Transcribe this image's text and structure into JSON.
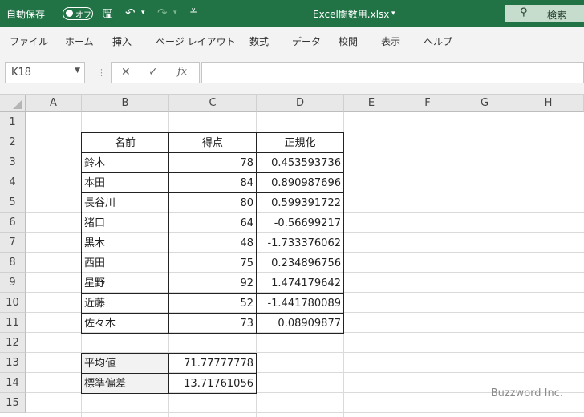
{
  "titlebar": {
    "autosave_label": "自動保存",
    "toggle_state": "オフ",
    "document_title": "Excel関数用.xlsx",
    "search_label": "検索"
  },
  "ribbon_tabs": [
    "ファイル",
    "ホーム",
    "挿入",
    "ページ レイアウト",
    "数式",
    "データ",
    "校閲",
    "表示",
    "ヘルプ"
  ],
  "formula_bar": {
    "name_box": "K18",
    "formula": ""
  },
  "columns": [
    "A",
    "B",
    "C",
    "D",
    "E",
    "F",
    "G",
    "H"
  ],
  "rows": [
    "1",
    "2",
    "3",
    "4",
    "5",
    "6",
    "7",
    "8",
    "9",
    "10",
    "11",
    "12",
    "13",
    "14",
    "15"
  ],
  "table": {
    "headers": [
      "名前",
      "得点",
      "正規化"
    ],
    "rows": [
      [
        "鈴木",
        "78",
        "0.453593736"
      ],
      [
        "本田",
        "84",
        "0.890987696"
      ],
      [
        "長谷川",
        "80",
        "0.599391722"
      ],
      [
        "猪口",
        "64",
        "-0.56699217"
      ],
      [
        "黒木",
        "48",
        "-1.733376062"
      ],
      [
        "西田",
        "75",
        "0.234896756"
      ],
      [
        "星野",
        "92",
        "1.474179642"
      ],
      [
        "近藤",
        "52",
        "-1.441780089"
      ],
      [
        "佐々木",
        "73",
        "0.08909877"
      ]
    ]
  },
  "stats": [
    {
      "label": "平均値",
      "value": "71.77777778"
    },
    {
      "label": "標準偏差",
      "value": "13.71761056"
    }
  ],
  "watermark": "Buzzword Inc."
}
